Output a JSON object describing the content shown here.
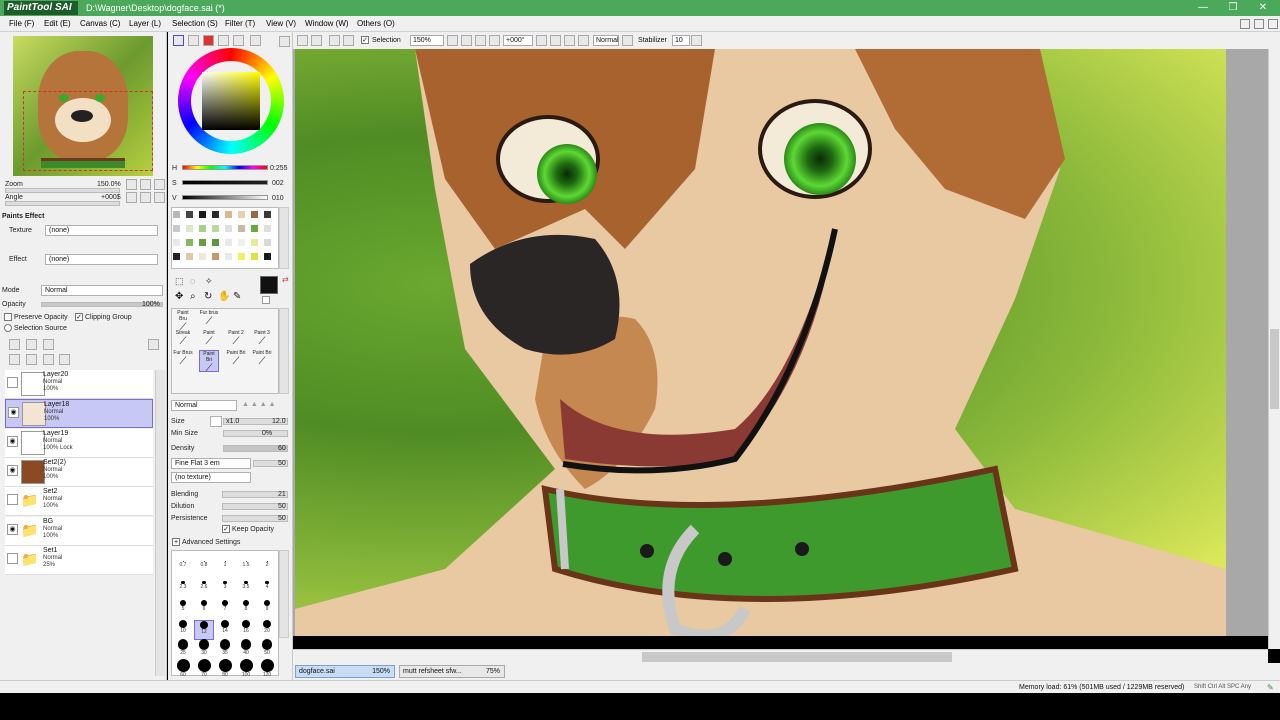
{
  "app": {
    "logo": "PaintTool SAI",
    "title": "D:\\Wagner\\Desktop\\dogface.sai (*)",
    "win_minimize": "—",
    "win_maximize": "❐",
    "win_close": "✕"
  },
  "menu": [
    "File (F)",
    "Edit (E)",
    "Canvas (C)",
    "Layer (L)",
    "Selection (S)",
    "Filter (T)",
    "View (V)",
    "Window (W)",
    "Others (O)"
  ],
  "toolbar": {
    "selection_label": "Selection",
    "zoom": "150%",
    "angle": "+000°",
    "blend_mode": "Normal",
    "stabilizer_label": "Stabilizer",
    "stabilizer_value": "10"
  },
  "navigator": {
    "zoom_label": "Zoom",
    "zoom_value": "150.0%",
    "angle_label": "Angle",
    "angle_value": "+000$"
  },
  "paint_effect": {
    "header": "Paints Effect",
    "texture_label": "Texture",
    "texture_value": "(none)",
    "effect_label": "Effect",
    "effect_value": "(none)"
  },
  "layer_props": {
    "mode_label": "Mode",
    "mode_value": "Normal",
    "opacity_label": "Opacity",
    "opacity_value": "100%",
    "preserve_opacity": "Preserve Opacity",
    "clipping_group": "Clipping Group",
    "selection_source": "Selection Source"
  },
  "layers": [
    {
      "name": "Layer20",
      "mode": "Normal",
      "opacity": "100%",
      "visible": false,
      "selected": false,
      "folder": false
    },
    {
      "name": "Layer18",
      "mode": "Normal",
      "opacity": "100%",
      "visible": true,
      "selected": true,
      "folder": false
    },
    {
      "name": "Layer19",
      "mode": "Normal",
      "opacity": "100% Lock",
      "visible": true,
      "selected": false,
      "folder": false
    },
    {
      "name": "Set2(2)",
      "mode": "Normal",
      "opacity": "100%",
      "visible": true,
      "selected": false,
      "folder": false
    },
    {
      "name": "Set2",
      "mode": "Normal",
      "opacity": "100%",
      "visible": false,
      "selected": false,
      "folder": true
    },
    {
      "name": "BG",
      "mode": "Normal",
      "opacity": "100%",
      "visible": true,
      "selected": false,
      "folder": true
    },
    {
      "name": "Set1",
      "mode": "Normal",
      "opacity": "25%",
      "visible": false,
      "selected": false,
      "folder": true
    }
  ],
  "color": {
    "h_label": "H",
    "h_value": "0:255",
    "s_label": "S",
    "s_value": "002",
    "v_label": "V",
    "v_value": "010",
    "current_color": "#111111"
  },
  "brushes": [
    {
      "label": "Paint Bru"
    },
    {
      "label": "Fur brus"
    },
    {
      "label": "Streak"
    },
    {
      "label": "Paint"
    },
    {
      "label": "Paint 2"
    },
    {
      "label": "Paint 3"
    },
    {
      "label": "Fur Brus"
    },
    {
      "label": "Paint Bri"
    },
    {
      "label": "Paint Bri"
    },
    {
      "label": "Paint Bri"
    }
  ],
  "brush_settings": {
    "mode": "Normal",
    "size_label": "Size",
    "size_mult": "x1.0",
    "size_value": "12.0",
    "minsize_label": "Min Size",
    "minsize_value": "0%",
    "density_label": "Density",
    "density_value": "60",
    "shape": "Fine Flat 3 em",
    "shape_value": "50",
    "texture": "(no texture)",
    "blending_label": "Blending",
    "blending_value": "21",
    "dilution_label": "Dilution",
    "dilution_value": "50",
    "persistence_label": "Persistence",
    "persistence_value": "50",
    "keep_opacity": "Keep Opacity",
    "advanced": "Advanced Settings"
  },
  "brush_sizes": [
    "0.7",
    "0.8",
    "1",
    "1.5",
    "2",
    "2.3",
    "2.6",
    "3",
    "3.5",
    "4",
    "5",
    "6",
    "7",
    "8",
    "9",
    "10",
    "12",
    "14",
    "16",
    "20",
    "25",
    "30",
    "35",
    "40",
    "50",
    "60",
    "70",
    "80",
    "100",
    "120"
  ],
  "tabs": [
    {
      "name": "dogface.sai",
      "zoom": "150%"
    },
    {
      "name": "mutt refsheet sfw...",
      "zoom": "75%"
    }
  ],
  "status": {
    "memory": "Memory load: 61% (501MB used / 1229MB reserved)",
    "keys": "Shift Ctrl Alt SPC Any"
  }
}
